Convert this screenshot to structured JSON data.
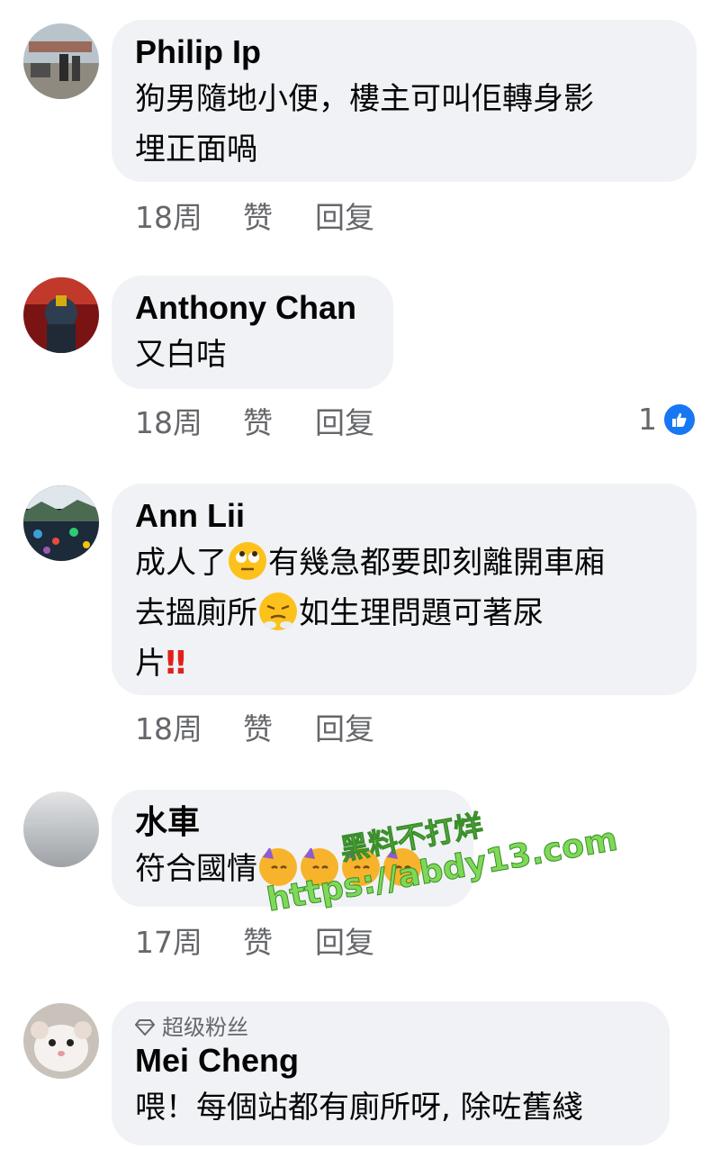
{
  "comments": [
    {
      "author": "Philip Ip",
      "lines": [
        "狗男隨地小便，樓主可叫佢轉身影",
        "埋正面喎"
      ],
      "time": "18周",
      "like": "赞",
      "reply": "回复"
    },
    {
      "author": "Anthony  Chan",
      "lines": [
        "又白咭"
      ],
      "time": "18周",
      "like": "赞",
      "reply": "回复",
      "reaction_count": "1",
      "reaction_icon": "thumbs-up-icon"
    },
    {
      "author": "Ann Lii",
      "line1_a": "成人了",
      "line1_b": "有幾急都要即刻離開車廂",
      "line2_a": "去搵廁所",
      "line2_b": "如生理問題可著尿",
      "line3_a": "片",
      "line3_bang": "‼",
      "time": "18周",
      "like": "赞",
      "reply": "回复"
    },
    {
      "author": "水車",
      "line1": "符合國情",
      "time": "17周",
      "like": "赞",
      "reply": "回复"
    },
    {
      "badge": "超级粉丝",
      "author": "Mei Cheng",
      "lines": [
        "喂！每個站都有廁所呀, 除咗舊綫"
      ]
    }
  ],
  "watermark": {
    "line1": "黑料不打烊",
    "line2": "https://abdy13.com"
  },
  "colors": {
    "bubble": "#f0f2f5",
    "meta_text": "#65676b",
    "like_blue": "#1877f2",
    "watermark_green": "#7ed957"
  }
}
